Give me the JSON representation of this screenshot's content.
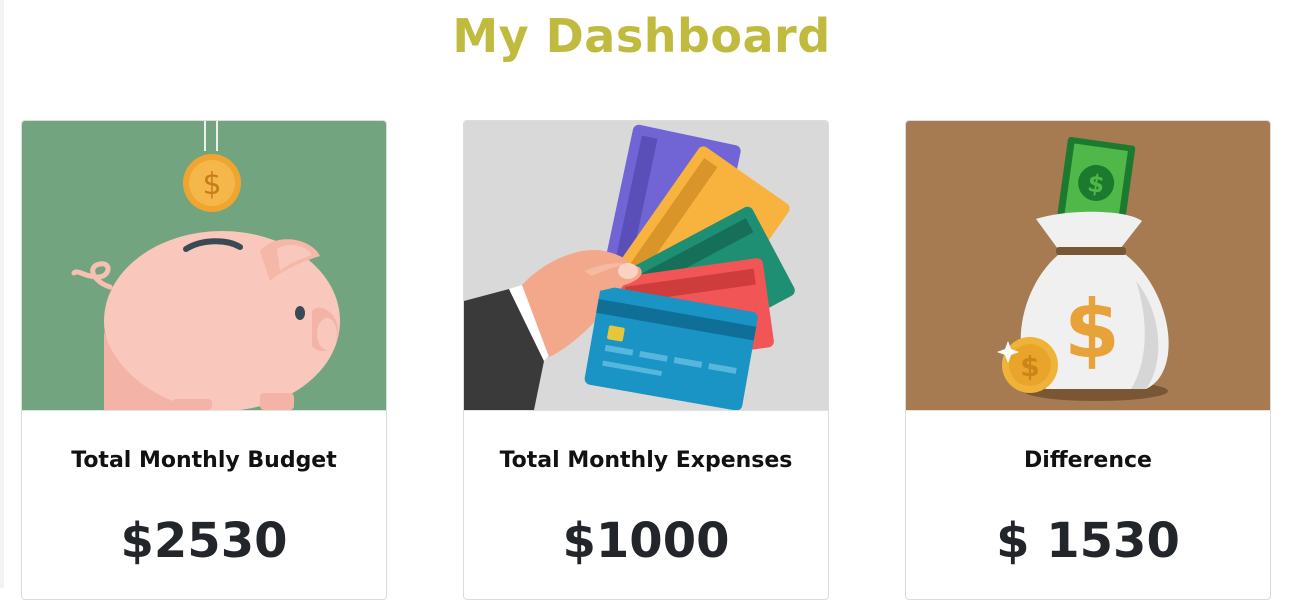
{
  "header": {
    "title": "My Dashboard"
  },
  "cards": [
    {
      "id": "budget",
      "label": "Total Monthly Budget",
      "value": "$2530",
      "illustration": "piggy-bank-icon",
      "bg": "#72a57f"
    },
    {
      "id": "expenses",
      "label": "Total Monthly Expenses",
      "value": "$1000",
      "illustration": "credit-cards-icon",
      "bg": "#d9d9d9"
    },
    {
      "id": "difference",
      "label": "Difference",
      "value": "$ 1530",
      "illustration": "money-bag-icon",
      "bg": "#a77b52"
    }
  ],
  "colors": {
    "title": "#c0bb3e",
    "value": "#222529",
    "label": "#111111"
  }
}
